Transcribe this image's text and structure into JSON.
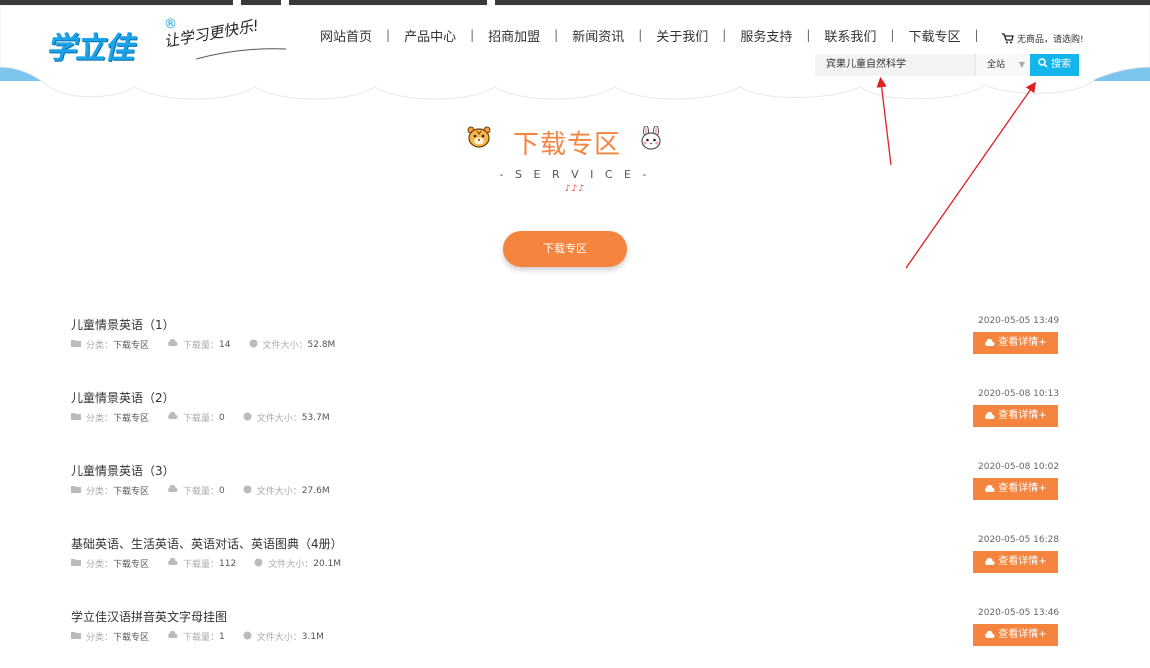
{
  "logo": {
    "brand": "学立佳",
    "registered": "®",
    "slogan": "让学习更快乐!"
  },
  "nav": {
    "items": [
      "网站首页",
      "产品中心",
      "招商加盟",
      "新闻资讯",
      "关于我们",
      "服务支持",
      "联系我们",
      "下载专区"
    ],
    "separator": "|"
  },
  "cart": {
    "text": "无商品，请选购!",
    "icon": "cart-icon"
  },
  "search": {
    "value": "宾果儿童自然科学",
    "scope": "全站",
    "button": "搜索",
    "icon": "search-icon"
  },
  "page": {
    "title": "下载专区",
    "subtitle": "- S E R V I C E -",
    "notes": "♪♪♪",
    "category_button": "下载专区"
  },
  "downloads": {
    "category_label": "分类：",
    "count_label": "下载量：",
    "size_label": "文件大小：",
    "detail_button": "查看详情+",
    "items": [
      {
        "name": "儿童情景英语（1）",
        "category": "下载专区",
        "count": "14",
        "size": "52.8M",
        "date": "2020-05-05 13:49"
      },
      {
        "name": "儿童情景英语（2）",
        "category": "下载专区",
        "count": "0",
        "size": "53.7M",
        "date": "2020-05-08 10:13"
      },
      {
        "name": "儿童情景英语（3）",
        "category": "下载专区",
        "count": "0",
        "size": "27.6M",
        "date": "2020-05-08 10:02"
      },
      {
        "name": "基础英语、生活英语、英语对话、英语图典（4册）",
        "category": "下载专区",
        "count": "112",
        "size": "20.1M",
        "date": "2020-05-05 16:28"
      },
      {
        "name": "学立佳汉语拼音英文字母挂图",
        "category": "下载专区",
        "count": "1",
        "size": "3.1M",
        "date": "2020-05-05 13:46"
      }
    ]
  },
  "colors": {
    "accent": "#f5843f",
    "brand": "#1aa3e8",
    "search_button": "#13b5ea",
    "sky": "#7cc6ee",
    "annotation": "#e02020"
  }
}
